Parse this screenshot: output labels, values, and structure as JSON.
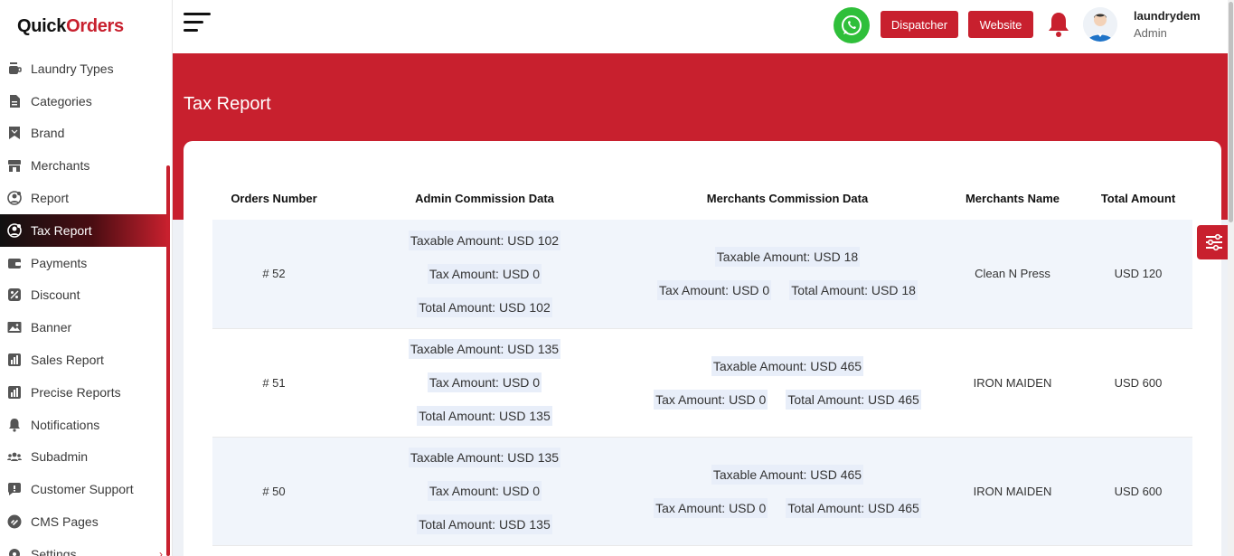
{
  "app": {
    "logo_part1": "Quick",
    "logo_part2": "Orders"
  },
  "sidebar": {
    "items": [
      {
        "label": "Laundry Types",
        "icon": "cup-icon"
      },
      {
        "label": "Categories",
        "icon": "document-icon"
      },
      {
        "label": "Brand",
        "icon": "bookmark-icon"
      },
      {
        "label": "Merchants",
        "icon": "store-icon"
      },
      {
        "label": "Report",
        "icon": "user-report-icon"
      },
      {
        "label": "Tax Report",
        "icon": "user-report-icon",
        "active": true
      },
      {
        "label": "Payments",
        "icon": "wallet-icon"
      },
      {
        "label": "Discount",
        "icon": "percent-icon"
      },
      {
        "label": "Banner",
        "icon": "image-icon"
      },
      {
        "label": "Sales Report",
        "icon": "chart-icon"
      },
      {
        "label": "Precise Reports",
        "icon": "chart-icon"
      },
      {
        "label": "Notifications",
        "icon": "bell-icon"
      },
      {
        "label": "Subadmin",
        "icon": "users-icon"
      },
      {
        "label": "Customer Support",
        "icon": "chat-icon"
      },
      {
        "label": "CMS Pages",
        "icon": "link-icon"
      },
      {
        "label": "Settings",
        "icon": "gear-icon"
      }
    ]
  },
  "header": {
    "dispatcher_label": "Dispatcher",
    "website_label": "Website",
    "user_name": "laundrydem",
    "user_role": "Admin"
  },
  "page": {
    "title": "Tax Report"
  },
  "table": {
    "columns": [
      "Orders Number",
      "Admin Commission Data",
      "Merchants Commission Data",
      "Merchants Name",
      "Total Amount"
    ],
    "rows": [
      {
        "order": "# 52",
        "admin_taxable": "Taxable Amount: USD 102",
        "admin_tax": "Tax Amount: USD 0",
        "admin_total": "Total Amount: USD 102",
        "merchant_taxable": "Taxable Amount: USD 18",
        "merchant_tax": "Tax Amount: USD 0",
        "merchant_total": "Total Amount: USD 18",
        "merchant_name": "Clean N Press",
        "total": "USD 120"
      },
      {
        "order": "# 51",
        "admin_taxable": "Taxable Amount: USD 135",
        "admin_tax": "Tax Amount: USD 0",
        "admin_total": "Total Amount: USD 135",
        "merchant_taxable": "Taxable Amount: USD 465",
        "merchant_tax": "Tax Amount: USD 0",
        "merchant_total": "Total Amount: USD 465",
        "merchant_name": "IRON MAIDEN",
        "total": "USD 600"
      },
      {
        "order": "# 50",
        "admin_taxable": "Taxable Amount: USD 135",
        "admin_tax": "Tax Amount: USD 0",
        "admin_total": "Total Amount: USD 135",
        "merchant_taxable": "Taxable Amount: USD 465",
        "merchant_tax": "Tax Amount: USD 0",
        "merchant_total": "Total Amount: USD 465",
        "merchant_name": "IRON MAIDEN",
        "total": "USD 600"
      }
    ]
  },
  "colors": {
    "brand": "#c8202e",
    "whatsapp": "#2fbf3a",
    "row_highlight": "#f1f5fb"
  }
}
